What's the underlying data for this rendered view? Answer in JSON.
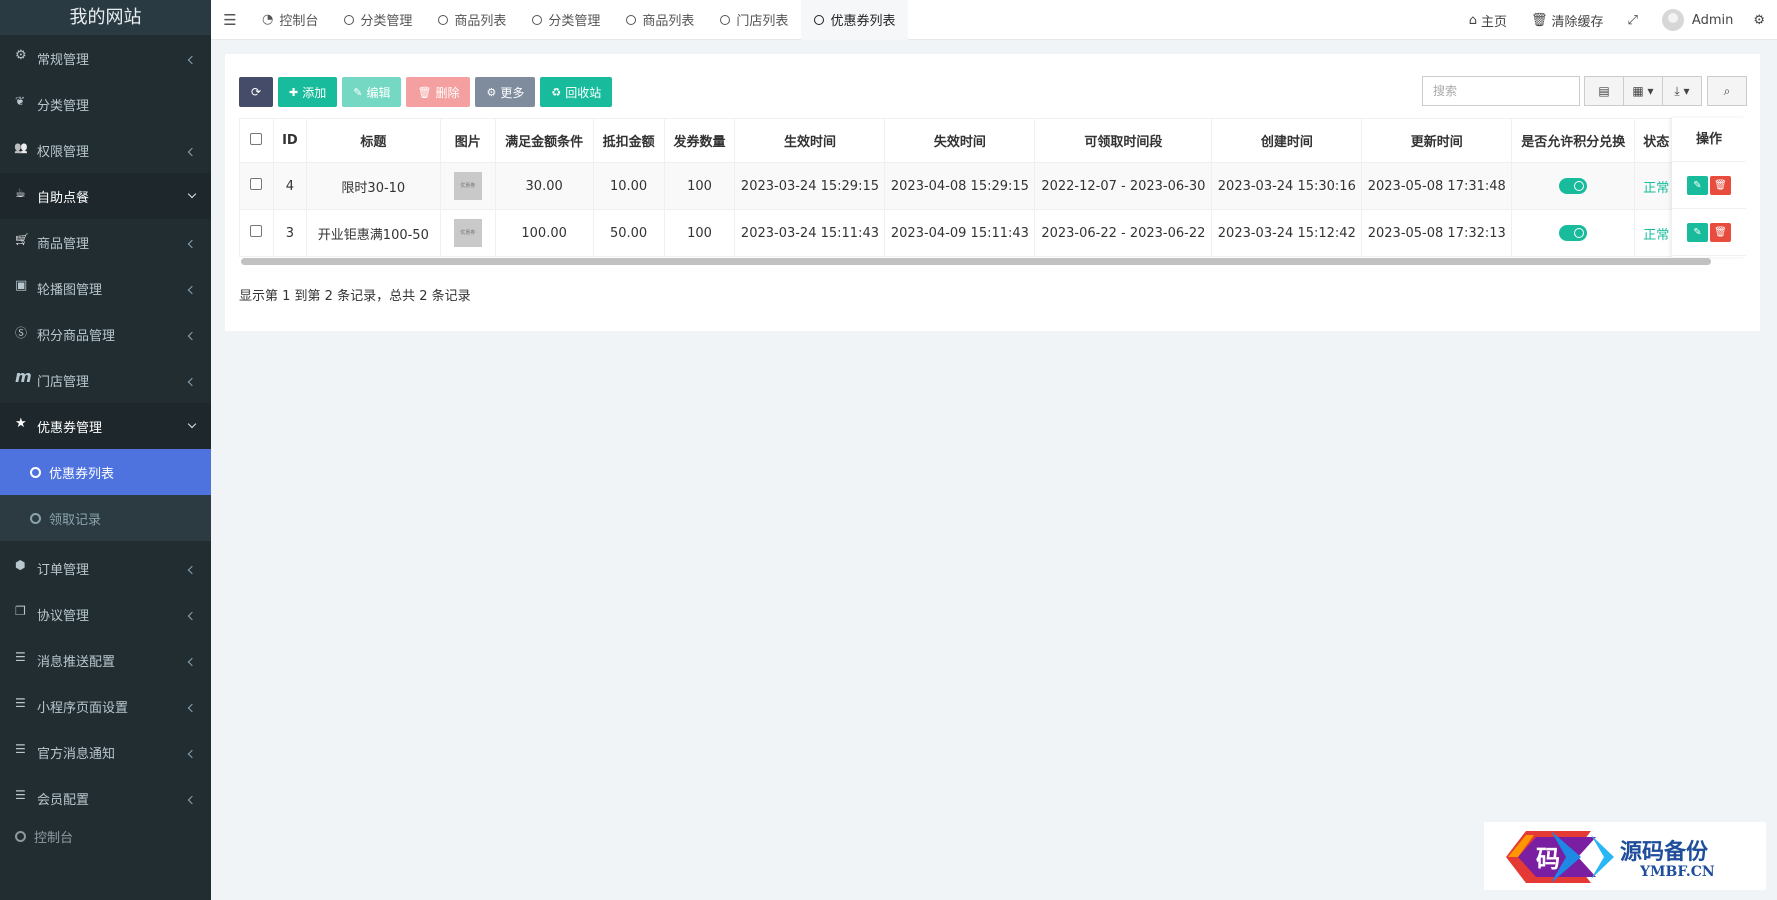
{
  "sidebar": {
    "logo": "我的网站",
    "items": [
      {
        "label": "常规管理"
      },
      {
        "label": "分类管理"
      },
      {
        "label": "权限管理"
      },
      {
        "label": "自助点餐"
      },
      {
        "label": "商品管理"
      },
      {
        "label": "轮播图管理"
      },
      {
        "label": "积分商品管理"
      },
      {
        "label": "门店管理"
      },
      {
        "label": "优惠券管理"
      },
      {
        "label": "优惠券列表"
      },
      {
        "label": "领取记录"
      },
      {
        "label": "订单管理"
      },
      {
        "label": "协议管理"
      },
      {
        "label": "消息推送配置"
      },
      {
        "label": "小程序页面设置"
      },
      {
        "label": "官方消息通知"
      },
      {
        "label": "会员配置"
      },
      {
        "label": "控制台"
      }
    ]
  },
  "topbar": {
    "tabs": [
      {
        "label": "控制台"
      },
      {
        "label": "分类管理"
      },
      {
        "label": "商品列表"
      },
      {
        "label": "分类管理"
      },
      {
        "label": "商品列表"
      },
      {
        "label": "门店列表"
      },
      {
        "label": "优惠券列表"
      }
    ],
    "home": "主页",
    "clear_cache": "清除缓存",
    "user": "Admin"
  },
  "toolbar": {
    "add": "添加",
    "edit": "编辑",
    "delete": "删除",
    "more": "更多",
    "recycle": "回收站",
    "search_placeholder": "搜索"
  },
  "table": {
    "headers": [
      "ID",
      "标题",
      "图片",
      "满足金额条件",
      "抵扣金额",
      "发券数量",
      "生效时间",
      "失效时间",
      "可领取时间段",
      "创建时间",
      "更新时间",
      "是否允许积分兑换",
      "状态"
    ],
    "ops_header": "操作",
    "thumb_text": "优惠券",
    "rows": [
      {
        "id": "4",
        "title": "限时30-10",
        "threshold": "30.00",
        "discount": "10.00",
        "count": "100",
        "start": "2023-03-24 15:29:15",
        "end": "2023-04-08 15:29:15",
        "period": "2022-12-07 - 2023-06-30",
        "created": "2023-03-24 15:30:16",
        "updated": "2023-05-08 17:31:48",
        "status": "正常"
      },
      {
        "id": "3",
        "title": "开业钜惠满100-50",
        "threshold": "100.00",
        "discount": "50.00",
        "count": "100",
        "start": "2023-03-24 15:11:43",
        "end": "2023-04-09 15:11:43",
        "period": "2023-06-22 - 2023-06-22",
        "created": "2023-03-24 15:12:42",
        "updated": "2023-05-08 17:32:13",
        "status": "正常"
      }
    ]
  },
  "footer": "显示第 1 到第 2 条记录，总共 2 条记录",
  "watermark": {
    "title": "源码备份",
    "sub": "YMBF.CN",
    "glyph": "码"
  },
  "colors": {
    "accent": "#4e73df",
    "green": "#18bc9c",
    "red": "#e74c3c",
    "sidebar": "#222d32"
  }
}
